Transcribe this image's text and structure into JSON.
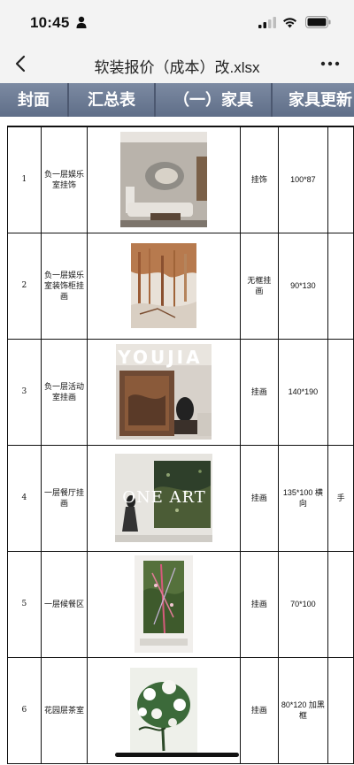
{
  "status_bar": {
    "time": "10:45"
  },
  "nav": {
    "title": "软装报价（成本）改.xlsx"
  },
  "tabs": [
    {
      "label": "封面"
    },
    {
      "label": "汇总表"
    },
    {
      "label": "（一）家具"
    },
    {
      "label": "家具更新"
    }
  ],
  "rows": [
    {
      "no": "1",
      "location": "负一层娱乐室挂饰",
      "type": "挂饰",
      "size": "100*87",
      "image": "round-wall-sculpture-living-room",
      "extra": ""
    },
    {
      "no": "2",
      "location": "负一层娱乐室装饰柜挂画",
      "type": "无框挂画",
      "size": "90*130",
      "image": "abstract-rust-painting",
      "extra": ""
    },
    {
      "no": "3",
      "location": "负一层活动室挂画",
      "type": "挂画",
      "size": "140*190",
      "image": "youjia-gallery-photo",
      "overlay": "YOUJIA",
      "extra": ""
    },
    {
      "no": "4",
      "location": "一层餐厅挂画",
      "type": "挂画",
      "size": "135*100 横向",
      "image": "one-art-green-painting",
      "overlay": "ONE ART",
      "extra": "手"
    },
    {
      "no": "5",
      "location": "一层候餐区",
      "type": "挂画",
      "size": "70*100",
      "image": "botanical-vertical-painting",
      "extra": ""
    },
    {
      "no": "6",
      "location": "花园层茶室",
      "type": "挂画",
      "size": "80*120 加黑框",
      "image": "white-floral-painting",
      "extra": ""
    }
  ],
  "colors": {
    "tab_bar": "#6b7a93",
    "nav_bg": "#f3f3f3"
  }
}
